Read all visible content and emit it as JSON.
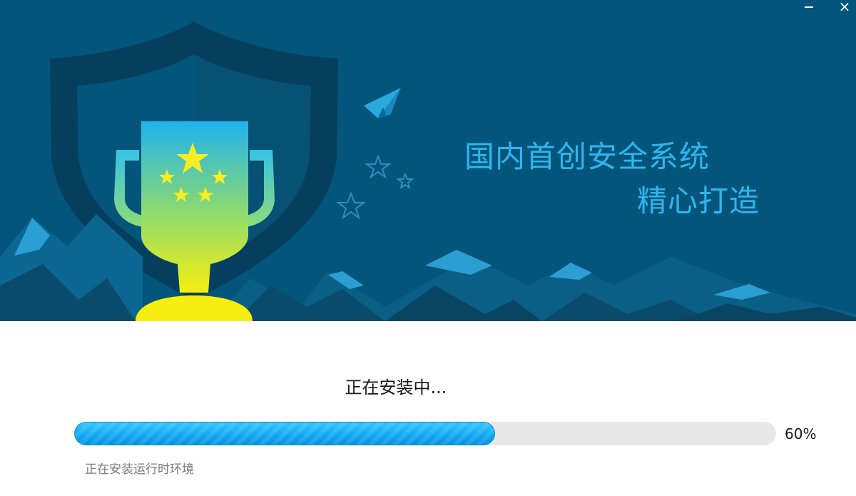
{
  "window": {
    "minimize_label": "",
    "close_label": "×"
  },
  "banner": {
    "slogan_line1": "国内首创安全系统",
    "slogan_line2": "精心打造"
  },
  "install": {
    "status_title": "正在安装中...",
    "progress_value": 0.6,
    "progress_text": "60%",
    "detail_text": "正在安装运行时环境"
  },
  "colors": {
    "banner_bg": "#03557b",
    "slogan": "#2fb6ee",
    "progress_fill": "#10a9f3",
    "progress_track": "#e8e8e8",
    "trophy_top": "#1fb2ef",
    "trophy_bottom": "#f5ee10"
  },
  "icons": [
    "trophy-icon",
    "shield-icon",
    "paper-plane-icon",
    "star-icon",
    "minimize-icon",
    "close-icon"
  ]
}
